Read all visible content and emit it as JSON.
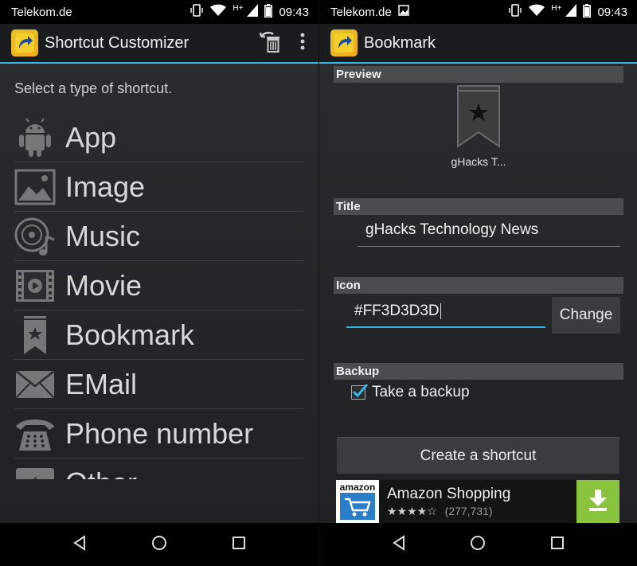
{
  "status": {
    "carrier": "Telekom.de",
    "time": "09:43",
    "network": "H+"
  },
  "left": {
    "app_title": "Shortcut Customizer",
    "prompt": "Select a type of shortcut.",
    "types": [
      {
        "label": "App",
        "icon": "android-icon"
      },
      {
        "label": "Image",
        "icon": "image-icon"
      },
      {
        "label": "Music",
        "icon": "music-icon"
      },
      {
        "label": "Movie",
        "icon": "movie-icon"
      },
      {
        "label": "Bookmark",
        "icon": "bookmark-icon"
      },
      {
        "label": "EMail",
        "icon": "email-icon"
      },
      {
        "label": "Phone number",
        "icon": "phone-icon"
      },
      {
        "label": "Other",
        "icon": "other-icon"
      }
    ]
  },
  "right": {
    "title": "Bookmark",
    "preview_header": "Preview",
    "preview_label": "gHacks T...",
    "title_header": "Title",
    "title_value": "gHacks Technology News",
    "icon_header": "Icon",
    "icon_value": "#FF3D3D3D",
    "change_label": "Change",
    "backup_header": "Backup",
    "backup_label": "Take a backup",
    "backup_checked": true,
    "create_label": "Create a shortcut"
  },
  "ad": {
    "brand": "amazon",
    "title": "Amazon Shopping",
    "stars": "★★★★☆",
    "rating_count": "(277,731)"
  },
  "colors": {
    "accent": "#33b5e5",
    "download": "#8ac43f",
    "app_icon": "#e2c62a"
  }
}
